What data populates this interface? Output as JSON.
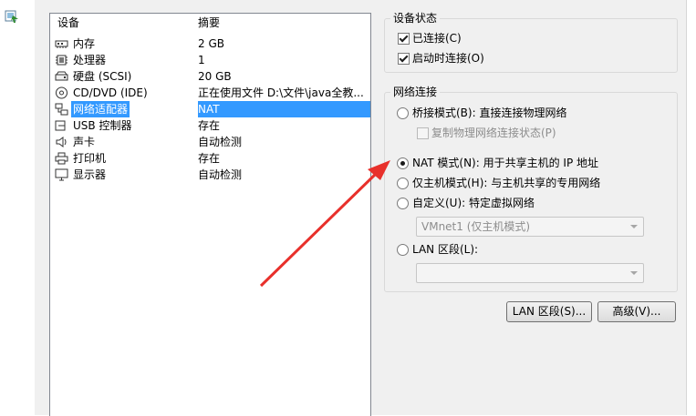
{
  "list": {
    "col_device": "设备",
    "col_summary": "摘要",
    "rows": [
      {
        "name": "内存",
        "summary": "2 GB",
        "icon": "memory-icon"
      },
      {
        "name": "处理器",
        "summary": "1",
        "icon": "cpu-icon"
      },
      {
        "name": "硬盘 (SCSI)",
        "summary": "20 GB",
        "icon": "hard-disk-icon"
      },
      {
        "name": "CD/DVD (IDE)",
        "summary": "正在使用文件 D:\\文件\\java全教...",
        "icon": "cd-dvd-icon"
      },
      {
        "name": "网络适配器",
        "summary": "NAT",
        "icon": "network-adapter-icon"
      },
      {
        "name": "USB 控制器",
        "summary": "存在",
        "icon": "usb-icon"
      },
      {
        "name": "声卡",
        "summary": "自动检测",
        "icon": "speaker-icon"
      },
      {
        "name": "打印机",
        "summary": "存在",
        "icon": "printer-icon"
      },
      {
        "name": "显示器",
        "summary": "自动检测",
        "icon": "monitor-icon"
      }
    ],
    "selected_index": 4
  },
  "device_status": {
    "title": "设备状态",
    "connected": {
      "label": "已连接(C)",
      "checked": true
    },
    "connect_on_power": {
      "label": "启动时连接(O)",
      "checked": true
    }
  },
  "network": {
    "title": "网络连接",
    "bridged": {
      "label": "桥接模式(B): 直接连接物理网络",
      "selected": false
    },
    "replicate": {
      "label": "复制物理网络连接状态(P)",
      "checked": false,
      "disabled": true
    },
    "nat": {
      "label": "NAT 模式(N): 用于共享主机的 IP 地址",
      "selected": true
    },
    "host_only": {
      "label": "仅主机模式(H): 与主机共享的专用网络",
      "selected": false
    },
    "custom": {
      "label": "自定义(U): 特定虚拟网络",
      "selected": false
    },
    "vmnet_value": "VMnet1 (仅主机模式)",
    "lan_segment": {
      "label": "LAN 区段(L):",
      "selected": false
    },
    "lan_value": ""
  },
  "buttons": {
    "lan_segments": "LAN 区段(S)...",
    "advanced": "高级(V)..."
  },
  "annotation": {
    "arrow_color": "#e8302b"
  }
}
